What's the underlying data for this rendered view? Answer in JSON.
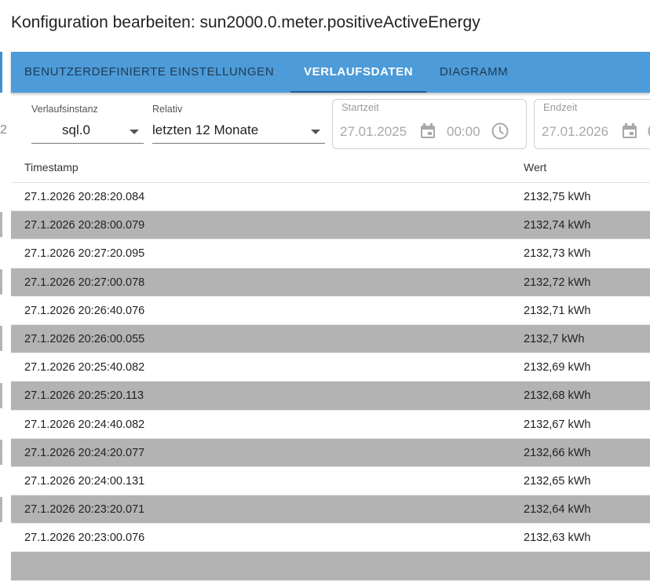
{
  "dialog": {
    "title": "Konfiguration bearbeiten: sun2000.0.meter.positiveActiveEnergy"
  },
  "tabs": [
    {
      "label": "BENUTZERDEFINIERTE EINSTELLUNGEN",
      "active": false
    },
    {
      "label": "VERLAUFSDATEN",
      "active": true
    },
    {
      "label": "DIAGRAMM",
      "active": false
    }
  ],
  "filters": {
    "instance": {
      "label": "Verlaufsinstanz",
      "value": "sql.0"
    },
    "relative": {
      "label": "Relativ",
      "value": "letzten 12 Monate"
    },
    "start": {
      "label": "Startzeit",
      "date": "27.01.2025",
      "time": "00:00"
    },
    "end": {
      "label": "Endzeit",
      "date": "27.01.2026"
    }
  },
  "table": {
    "columns": [
      "Timestamp",
      "Wert"
    ],
    "rows": [
      {
        "timestamp": "27.1.2026 20:28:20.084",
        "value": "2132,75 kWh"
      },
      {
        "timestamp": "27.1.2026 20:28:00.079",
        "value": "2132,74 kWh"
      },
      {
        "timestamp": "27.1.2026 20:27:20.095",
        "value": "2132,73 kWh"
      },
      {
        "timestamp": "27.1.2026 20:27:00.078",
        "value": "2132,72 kWh"
      },
      {
        "timestamp": "27.1.2026 20:26:40.076",
        "value": "2132,71 kWh"
      },
      {
        "timestamp": "27.1.2026 20:26:00.055",
        "value": "2132,7 kWh"
      },
      {
        "timestamp": "27.1.2026 20:25:40.082",
        "value": "2132,69 kWh"
      },
      {
        "timestamp": "27.1.2026 20:25:20.113",
        "value": "2132,68 kWh"
      },
      {
        "timestamp": "27.1.2026 20:24:40.082",
        "value": "2132,67 kWh"
      },
      {
        "timestamp": "27.1.2026 20:24:20.077",
        "value": "2132,66 kWh"
      },
      {
        "timestamp": "27.1.2026 20:24:00.131",
        "value": "2132,65 kWh"
      },
      {
        "timestamp": "27.1.2026 20:23:20.071",
        "value": "2132,64 kWh"
      },
      {
        "timestamp": "27.1.2026 20:23:00.076",
        "value": "2132,63 kWh"
      },
      {
        "timestamp": "",
        "value": ""
      }
    ]
  },
  "colors": {
    "tabbar": "#4d9bd8",
    "row_alt": "#b3b3b3",
    "tab_active": "#ffffff",
    "tab_inactive": "#1f3a52"
  }
}
